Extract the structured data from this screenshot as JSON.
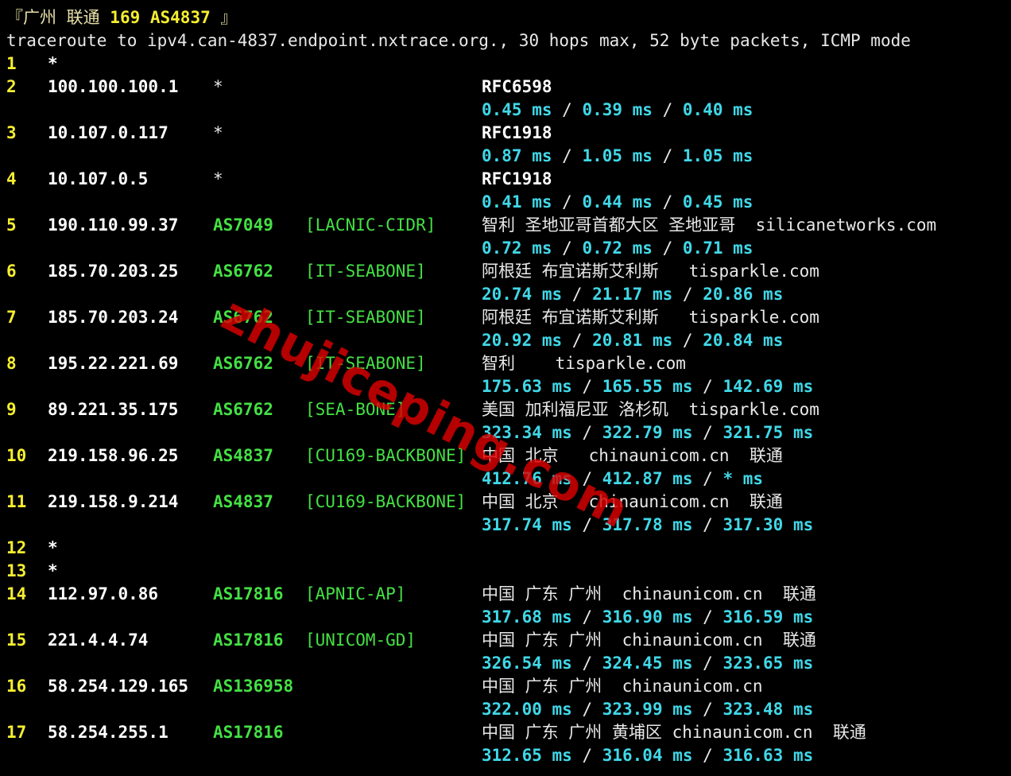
{
  "title": {
    "open": "『广州 联通 ",
    "highlight": "169 AS4837",
    "close": " 』"
  },
  "command": "traceroute to ipv4.can-4837.endpoint.nxtrace.org., 30 hops max, 52 byte packets, ICMP mode",
  "hops": [
    {
      "hop": "1",
      "ip": "*"
    },
    {
      "hop": "2",
      "ip": "100.100.100.1",
      "star": "*",
      "geo": "RFC6598",
      "rtt": [
        "0.45 ms",
        "0.39 ms",
        "0.40 ms"
      ]
    },
    {
      "hop": "3",
      "ip": "10.107.0.117",
      "star": "*",
      "geo": "RFC1918",
      "rtt": [
        "0.87 ms",
        "1.05 ms",
        "1.05 ms"
      ]
    },
    {
      "hop": "4",
      "ip": "10.107.0.5",
      "star": "*",
      "geo": "RFC1918",
      "rtt": [
        "0.41 ms",
        "0.44 ms",
        "0.45 ms"
      ]
    },
    {
      "hop": "5",
      "ip": "190.110.99.37",
      "asn": "AS7049",
      "tag": "[LACNIC-CIDR]",
      "geo": "智利 圣地亚哥首都大区 圣地亚哥  silicanetworks.com",
      "rtt": [
        "0.72 ms",
        "0.72 ms",
        "0.71 ms"
      ]
    },
    {
      "hop": "6",
      "ip": "185.70.203.25",
      "asn": "AS6762",
      "tag": "[IT-SEABONE]",
      "geo": "阿根廷 布宜诺斯艾利斯   tisparkle.com",
      "rtt": [
        "20.74 ms",
        "21.17 ms",
        "20.86 ms"
      ]
    },
    {
      "hop": "7",
      "ip": "185.70.203.24",
      "asn": "AS6762",
      "tag": "[IT-SEABONE]",
      "geo": "阿根廷 布宜诺斯艾利斯   tisparkle.com",
      "rtt": [
        "20.92 ms",
        "20.81 ms",
        "20.84 ms"
      ]
    },
    {
      "hop": "8",
      "ip": "195.22.221.69",
      "asn": "AS6762",
      "tag": "[IT-SEABONE]",
      "geo": "智利    tisparkle.com",
      "rtt": [
        "175.63 ms",
        "165.55 ms",
        "142.69 ms"
      ]
    },
    {
      "hop": "9",
      "ip": "89.221.35.175",
      "asn": "AS6762",
      "tag": "[SEA-BONE]",
      "geo": "美国 加利福尼亚 洛杉矶  tisparkle.com",
      "rtt": [
        "323.34 ms",
        "322.79 ms",
        "321.75 ms"
      ]
    },
    {
      "hop": "10",
      "ip": "219.158.96.25",
      "asn": "AS4837",
      "tag": "[CU169-BACKBONE]",
      "geo": "中国 北京   chinaunicom.cn  联通",
      "rtt": [
        "412.76 ms",
        "412.87 ms",
        "* ms"
      ]
    },
    {
      "hop": "11",
      "ip": "219.158.9.214",
      "asn": "AS4837",
      "tag": "[CU169-BACKBONE]",
      "geo": "中国 北京   chinaunicom.cn  联通",
      "rtt": [
        "317.74 ms",
        "317.78 ms",
        "317.30 ms"
      ]
    },
    {
      "hop": "12",
      "ip": "*"
    },
    {
      "hop": "13",
      "ip": "*"
    },
    {
      "hop": "14",
      "ip": "112.97.0.86",
      "asn": "AS17816",
      "tag": "[APNIC-AP]",
      "geo": "中国 广东 广州  chinaunicom.cn  联通",
      "rtt": [
        "317.68 ms",
        "316.90 ms",
        "316.59 ms"
      ]
    },
    {
      "hop": "15",
      "ip": "221.4.4.74",
      "asn": "AS17816",
      "tag": "[UNICOM-GD]",
      "geo": "中国 广东 广州  chinaunicom.cn  联通",
      "rtt": [
        "326.54 ms",
        "324.45 ms",
        "323.65 ms"
      ]
    },
    {
      "hop": "16",
      "ip": "58.254.129.165",
      "asn": "AS136958",
      "geo": "中国 广东 广州  chinaunicom.cn",
      "rtt": [
        "322.00 ms",
        "323.99 ms",
        "323.48 ms"
      ]
    },
    {
      "hop": "17",
      "ip": "58.254.255.1",
      "asn": "AS17816",
      "geo": "中国 广东 广州 黄埔区 chinaunicom.cn  联通",
      "rtt": [
        "312.65 ms",
        "316.04 ms",
        "316.63 ms"
      ]
    }
  ],
  "rtt_separator": " / ",
  "watermark": "zhujiceping.com",
  "colors": {
    "background": "#000000",
    "hop_number": "#f5ee30",
    "asn": "#44e044",
    "rtt": "#40d8e8",
    "watermark": "#dc0000"
  }
}
